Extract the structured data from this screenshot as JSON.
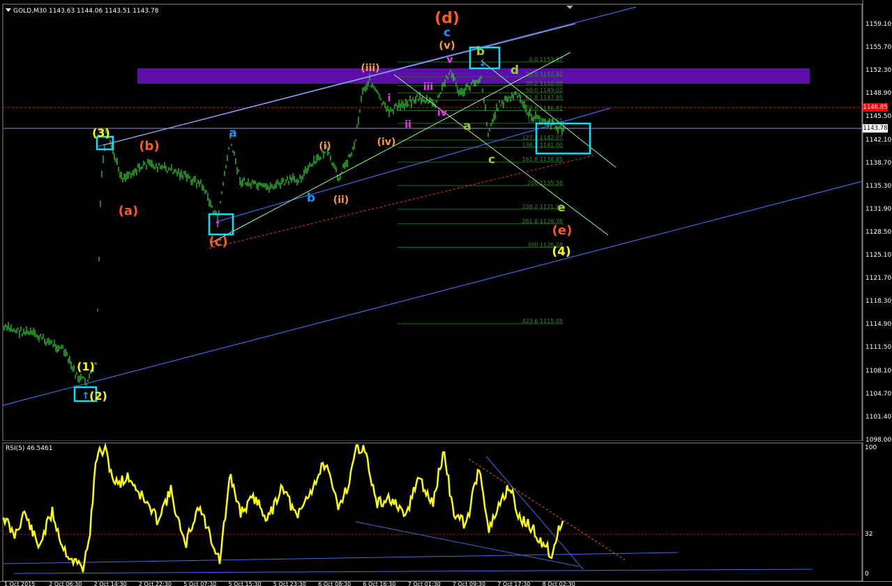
{
  "header": {
    "symbol_title": "GOLD,M30",
    "ohlc": "1143.63 1144.06 1143.51 1143.78",
    "menu_icon": "triangle-down-icon"
  },
  "price_axis": {
    "labels": [
      "1159.10",
      "1155.70",
      "1152.30",
      "1148.90",
      "1145.50",
      "1142.10",
      "1138.70",
      "1135.30",
      "1131.90",
      "1128.50",
      "1125.10",
      "1121.70",
      "1118.30",
      "1114.90",
      "1111.50",
      "1108.10",
      "1104.70",
      "1101.40",
      "1098.00"
    ],
    "current_price": "1143.78",
    "red_line_price": "1146.85",
    "colors": {
      "current_box_bg": "#ffffff",
      "red_box_bg": "#ff0000"
    }
  },
  "rsi": {
    "title": "RSI(5) 46.5461",
    "levels": [
      "100",
      "32",
      "0"
    ],
    "line_color": "#ffff00"
  },
  "time_axis": {
    "labels": [
      "1 Oct 2015",
      "2 Oct 06:30",
      "2 Oct 14:30",
      "2 Oct 22:30",
      "5 Oct 07:30",
      "5 Oct 15:30",
      "5 Oct 23:30",
      "6 Oct 08:30",
      "6 Oct 16:30",
      "7 Oct 01:30",
      "7 Oct 09:30",
      "7 Oct 17:30",
      "8 Oct 02:30"
    ]
  },
  "fib_levels": [
    "0.0 1153.57",
    "23.6 1151.42",
    "38.2 1150.09",
    "50.0 1149.02",
    "61.8 1147.95",
    "78.6 1146.42",
    "100 1144.55",
    "127.2 1142.07",
    "138.2 1141.00",
    "161.8 1138.85",
    "200 1135.38",
    "238.2 1131.90",
    "261.8 1129.76",
    "300 1126.28",
    "423.6 1115.05"
  ],
  "wave_labels": [
    {
      "text": "(d)",
      "color": "#ff5a1a"
    },
    {
      "text": "c",
      "color": "#1e90ff"
    },
    {
      "text": "(v)",
      "color": "#ff9933"
    },
    {
      "text": "b",
      "color": "#9acd32"
    },
    {
      "text": "d",
      "color": "#9acd32"
    },
    {
      "text": "(iii)",
      "color": "#ff9933"
    },
    {
      "text": "i",
      "color": "#ff33ff"
    },
    {
      "text": "iii",
      "color": "#ff33ff"
    },
    {
      "text": "v",
      "color": "#ff33ff"
    },
    {
      "text": "iv",
      "color": "#ff33ff"
    },
    {
      "text": "ii",
      "color": "#ff33ff"
    },
    {
      "text": "a",
      "color": "#9acd32"
    },
    {
      "text": "(iv)",
      "color": "#ff9933"
    },
    {
      "text": "c",
      "color": "#9acd32"
    },
    {
      "text": "(3)",
      "color": "#ffff00"
    },
    {
      "text": "(b)",
      "color": "#ff5a1a"
    },
    {
      "text": "a",
      "color": "#1e90ff"
    },
    {
      "text": "(i)",
      "color": "#ff9933"
    },
    {
      "text": "b",
      "color": "#1e90ff"
    },
    {
      "text": "(ii)",
      "color": "#ff9933"
    },
    {
      "text": "(a)",
      "color": "#ff5a1a"
    },
    {
      "text": "(c)",
      "color": "#ff5a1a"
    },
    {
      "text": "e",
      "color": "#9acd32"
    },
    {
      "text": "(e)",
      "color": "#ff5a1a"
    },
    {
      "text": "(4)",
      "color": "#ffff00"
    },
    {
      "text": "(1)",
      "color": "#ffff00"
    },
    {
      "text": "(2)",
      "color": "#ffff00"
    }
  ],
  "colors": {
    "background": "#000000",
    "candles": "#32cd32",
    "trendlines": "#4169e1",
    "highlight_box": "#00e5ff",
    "resistance_zone": "#5b0fa8",
    "dotted_red": "#ff0000"
  }
}
